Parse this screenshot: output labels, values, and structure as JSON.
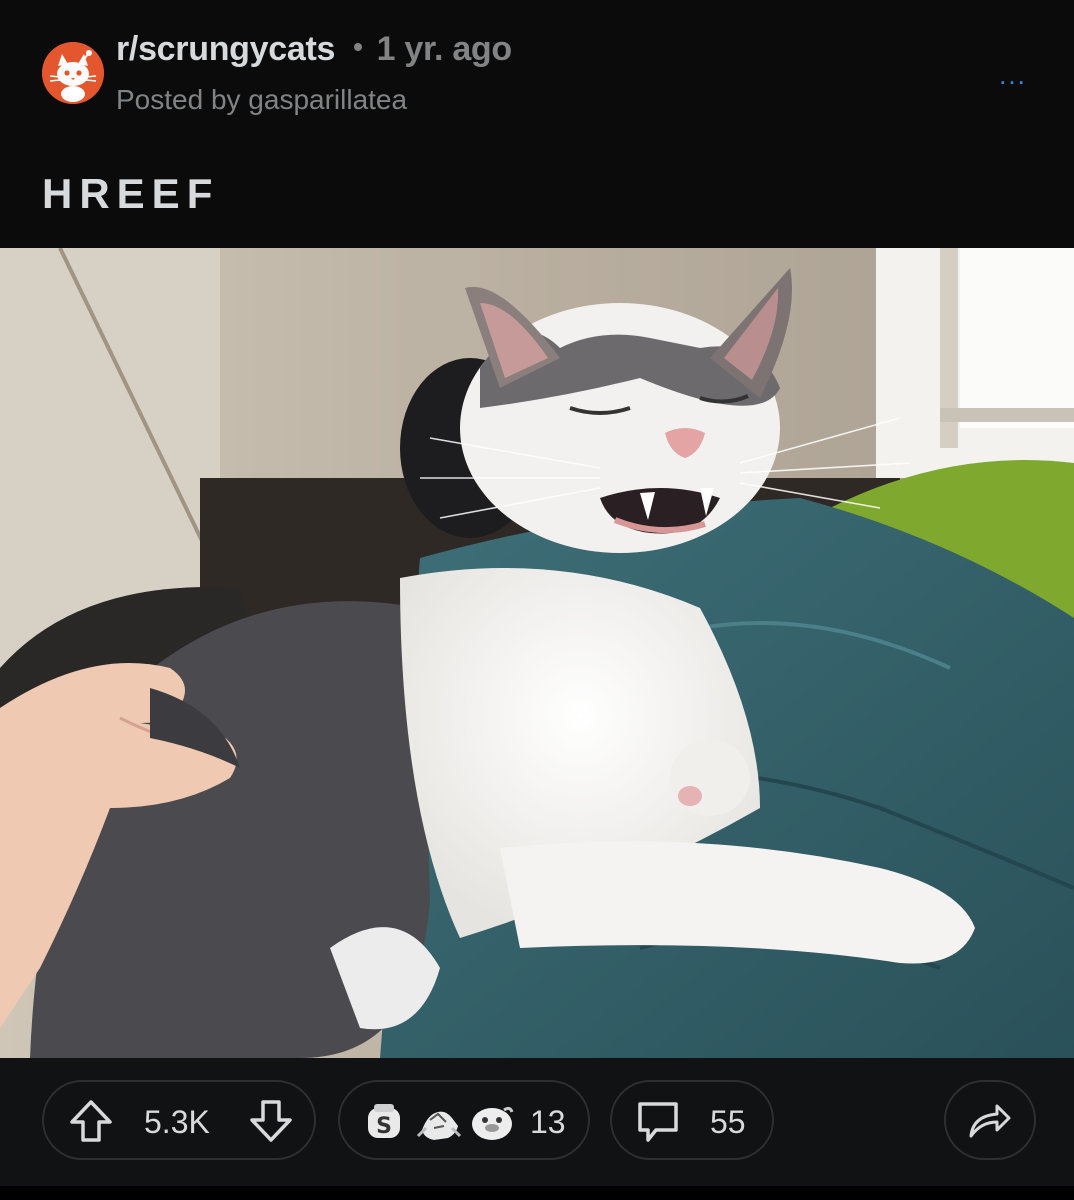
{
  "header": {
    "subreddit": "r/scrungycats",
    "separator": "•",
    "time_ago": "1 yr. ago",
    "posted_by": "Posted by gasparillatea",
    "more_label": "..."
  },
  "post": {
    "title": "HREEF"
  },
  "actions": {
    "upvotes": "5.3K",
    "awards_count": "13",
    "comments": "55"
  },
  "icons": {
    "avatar": "snoo-cat-avatar-icon",
    "upvote": "arrow-up-icon",
    "downvote": "arrow-down-icon",
    "award_1": "silver-award-icon",
    "award_2": "handshake-award-icon",
    "award_3": "seal-award-icon",
    "comment": "speech-bubble-icon",
    "share": "share-arrow-icon",
    "more": "ellipsis-icon"
  },
  "colors": {
    "background": "#0b0b0c",
    "action_bar": "#111214",
    "text_primary": "#d7dadc",
    "text_muted": "#818384",
    "avatar_bg": "#e4572e",
    "accent_blue": "#2f8ae0"
  }
}
